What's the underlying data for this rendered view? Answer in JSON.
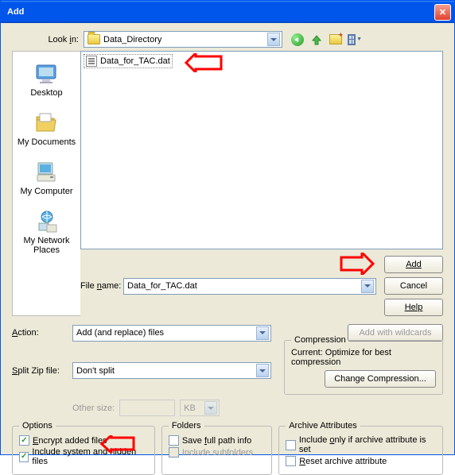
{
  "window": {
    "title": "Add"
  },
  "lookin": {
    "label": "Look in:",
    "label_underline": "i",
    "value": "Data_Directory"
  },
  "places": {
    "desktop": "Desktop",
    "documents": "My Documents",
    "computer": "My Computer",
    "network": "My Network Places"
  },
  "file_list": {
    "items": [
      {
        "name": "Data_for_TAC.dat"
      }
    ]
  },
  "filename": {
    "label": "File name:",
    "label_underline": "n",
    "value": "Data_for_TAC.dat"
  },
  "buttons": {
    "add": "Add",
    "cancel": "Cancel",
    "help": "Help",
    "add_wildcards": "Add with wildcards",
    "change_compression": "Change Compression..."
  },
  "action": {
    "label": "Action:",
    "label_underline": "A",
    "value": "Add (and replace) files"
  },
  "split": {
    "label": "Split Zip file:",
    "label_underline": "S",
    "value": "Don't split"
  },
  "othersize": {
    "label": "Other size:",
    "unit": "KB"
  },
  "compression": {
    "legend": "Compression",
    "current": "Current: Optimize for best compression"
  },
  "options": {
    "legend": "Options",
    "encrypt": "Encrypt added files",
    "encrypt_underline": "E",
    "include_hidden": "Include system and hidden files"
  },
  "folders": {
    "legend": "Folders",
    "full_path": "Save full path info",
    "full_path_underline": "f",
    "subfolders": "Include subfolders"
  },
  "archive": {
    "legend": "Archive Attributes",
    "include_only": "Include only if archive attribute is set",
    "include_only_underline": "o",
    "reset": "Reset archive attribute",
    "reset_underline": "R"
  }
}
